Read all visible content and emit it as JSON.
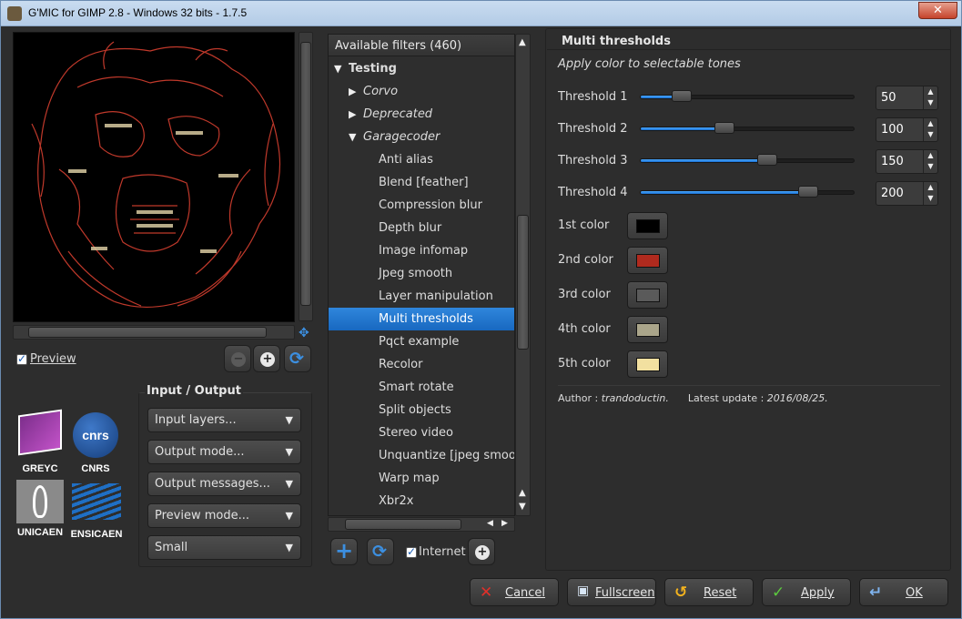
{
  "window": {
    "title": "G'MIC for GIMP 2.8 - Windows 32 bits - 1.7.5",
    "close_label": "✕"
  },
  "preview": {
    "checkbox_label": "Preview",
    "checked": true
  },
  "logos": [
    {
      "label": "GREYC"
    },
    {
      "label": "CNRS",
      "mark": "cnrs"
    },
    {
      "label": "UNICAEN"
    },
    {
      "label": "ENSICAEN"
    }
  ],
  "input_output": {
    "title": "Input / Output",
    "combos": [
      {
        "value": "Input layers..."
      },
      {
        "value": "Output mode..."
      },
      {
        "value": "Output messages..."
      },
      {
        "value": "Preview mode..."
      },
      {
        "value": "Small"
      }
    ]
  },
  "filters": {
    "header": "Available filters (460)",
    "rows": [
      {
        "label": "Testing",
        "level": 0,
        "expanded": true
      },
      {
        "label": "Corvo",
        "level": 1,
        "expanded": false
      },
      {
        "label": "Deprecated",
        "level": 1,
        "expanded": false
      },
      {
        "label": "Garagecoder",
        "level": 1,
        "expanded": true
      },
      {
        "label": "Anti alias",
        "level": 2
      },
      {
        "label": "Blend [feather]",
        "level": 2
      },
      {
        "label": "Compression blur",
        "level": 2
      },
      {
        "label": "Depth blur",
        "level": 2
      },
      {
        "label": "Image infomap",
        "level": 2
      },
      {
        "label": "Jpeg smooth",
        "level": 2
      },
      {
        "label": "Layer manipulation",
        "level": 2
      },
      {
        "label": "Multi thresholds",
        "level": 2,
        "selected": true
      },
      {
        "label": "Pqct example",
        "level": 2
      },
      {
        "label": "Recolor",
        "level": 2
      },
      {
        "label": "Smart rotate",
        "level": 2
      },
      {
        "label": "Split objects",
        "level": 2
      },
      {
        "label": "Stereo video",
        "level": 2
      },
      {
        "label": "Unquantize [jpeg smooth]",
        "level": 2
      },
      {
        "label": "Warp map",
        "level": 2
      },
      {
        "label": "Xbr2x",
        "level": 2
      }
    ],
    "internet_label": "Internet",
    "internet_checked": true
  },
  "filter": {
    "title": "Multi thresholds",
    "description": "Apply color to selectable tones",
    "thresholds": [
      {
        "label": "Threshold 1",
        "value": "50",
        "fraction": 0.19
      },
      {
        "label": "Threshold 2",
        "value": "100",
        "fraction": 0.39
      },
      {
        "label": "Threshold 3",
        "value": "150",
        "fraction": 0.59
      },
      {
        "label": "Threshold 4",
        "value": "200",
        "fraction": 0.78
      }
    ],
    "colors": [
      {
        "label": "1st color",
        "hex": "#000000"
      },
      {
        "label": "2nd color",
        "hex": "#b02a1e"
      },
      {
        "label": "3rd color",
        "hex": "#5a5a5a"
      },
      {
        "label": "4th color",
        "hex": "#aaa58a"
      },
      {
        "label": "5th color",
        "hex": "#f2e0a0"
      }
    ],
    "author_prefix": "Author :",
    "author": "trandoductin.",
    "update_prefix": "Latest update :",
    "update": "2016/08/25."
  },
  "buttons": {
    "cancel": "Cancel",
    "fullscreen": "Fullscreen",
    "reset": "Reset",
    "apply": "Apply",
    "ok": "OK"
  },
  "colors": {
    "accent": "#1a6fd0",
    "background": "#2d2d2d"
  }
}
